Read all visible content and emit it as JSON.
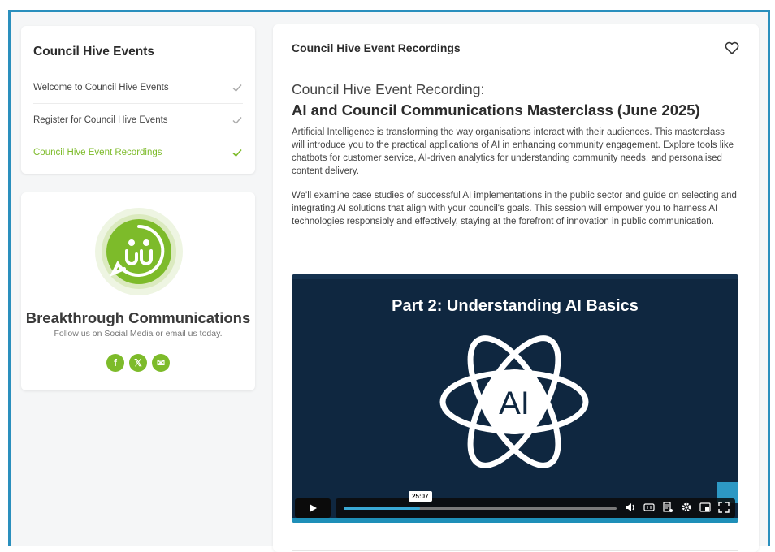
{
  "sidebar": {
    "title": "Council Hive Events",
    "items": [
      {
        "label": "Welcome to Council Hive Events",
        "status": "complete"
      },
      {
        "label": "Register for Council Hive Events",
        "status": "complete"
      },
      {
        "label": "Council Hive Event Recordings",
        "status": "active"
      }
    ]
  },
  "profile": {
    "name": "Breakthrough Communications",
    "subtitle": "Follow us on Social Media or email us today.",
    "socials": [
      {
        "icon": "facebook-icon",
        "glyph": "f"
      },
      {
        "icon": "x-icon",
        "glyph": "𝕏"
      },
      {
        "icon": "email-icon",
        "glyph": "✉"
      }
    ]
  },
  "main": {
    "header_title": "Council Hive Event Recordings",
    "recording_label": "Council Hive Event Recording:",
    "recording_title": "AI and Council Communications Masterclass (June 2025)",
    "paragraphs": [
      "Artificial Intelligence is transforming the way organisations interact with their audiences. This masterclass will introduce you to the practical applications of AI in enhancing community engagement. Explore tools like chatbots for customer service, AI-driven analytics for understanding community needs, and personalised content delivery.",
      "We'll examine case studies of successful AI implementations in the public sector and guide on selecting and integrating AI solutions that align with your council's goals. This session will empower you to harness AI technologies responsibly and effectively, staying at the forefront of innovation in public communication."
    ]
  },
  "video": {
    "slide_title": "Part 2: Understanding AI Basics",
    "center_text": "AI",
    "hover_time": "25:07",
    "progress": 0.28
  },
  "colors": {
    "accent": "#7dbb2a",
    "frame": "#2a8fbd",
    "video_bg": "#0f2740"
  }
}
